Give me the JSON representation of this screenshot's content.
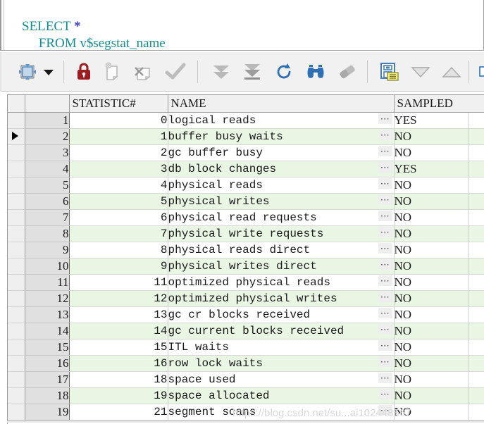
{
  "editor": {
    "line1": {
      "keyword": "SELECT",
      "operator": "*"
    },
    "line2": {
      "keyword": "FROM",
      "object": "v$segstat_name"
    },
    "full_text": "SELECT *\n     FROM v$segstat_name"
  },
  "toolbar": {
    "buttons": [
      {
        "name": "grid-data-button",
        "icon": "grid-data-icon",
        "label": "",
        "enabled": true
      },
      {
        "name": "grid-dropdown-button",
        "icon": "chevron-down-icon",
        "label": "",
        "enabled": true
      },
      {
        "name": "lock-record-button",
        "icon": "lock-icon",
        "label": "",
        "enabled": true
      },
      {
        "name": "insert-record-button",
        "icon": "new-record-icon",
        "label": "",
        "enabled": false
      },
      {
        "name": "delete-record-button",
        "icon": "delete-record-icon",
        "label": "",
        "enabled": false
      },
      {
        "name": "post-changes-button",
        "icon": "checkmark-icon",
        "label": "",
        "enabled": false
      },
      {
        "name": "fetch-next-page-button",
        "icon": "double-down-arrow-icon",
        "label": "",
        "enabled": true
      },
      {
        "name": "fetch-all-rows-button",
        "icon": "down-arrow-to-bar-icon",
        "label": "",
        "enabled": true
      },
      {
        "name": "refresh-button",
        "icon": "refresh-icon",
        "label": "",
        "enabled": true
      },
      {
        "name": "find-button",
        "icon": "binoculars-icon",
        "label": "",
        "enabled": true
      },
      {
        "name": "clear-filter-button",
        "icon": "eraser-icon",
        "label": "",
        "enabled": true
      },
      {
        "name": "single-record-view-button",
        "icon": "record-form-icon",
        "label": "",
        "enabled": true
      },
      {
        "name": "sort-descending-button",
        "icon": "triangle-down-icon",
        "label": "",
        "enabled": true
      },
      {
        "name": "sort-ascending-button",
        "icon": "triangle-up-icon",
        "label": "",
        "enabled": true
      }
    ]
  },
  "grid": {
    "columns": [
      {
        "key": "rownum",
        "label": ""
      },
      {
        "key": "statistic",
        "label": "STATISTIC#"
      },
      {
        "key": "name",
        "label": "NAME"
      },
      {
        "key": "sampled",
        "label": "SAMPLED"
      }
    ],
    "dots_label": "⋯",
    "current_row_index": 2,
    "rows": [
      {
        "rownum": "1",
        "statistic": "0",
        "name": "logical reads",
        "sampled": "YES"
      },
      {
        "rownum": "2",
        "statistic": "1",
        "name": "buffer busy waits",
        "sampled": "NO"
      },
      {
        "rownum": "3",
        "statistic": "2",
        "name": "gc buffer busy",
        "sampled": "NO"
      },
      {
        "rownum": "4",
        "statistic": "3",
        "name": "db block changes",
        "sampled": "YES"
      },
      {
        "rownum": "5",
        "statistic": "4",
        "name": "physical reads",
        "sampled": "NO"
      },
      {
        "rownum": "6",
        "statistic": "5",
        "name": "physical writes",
        "sampled": "NO"
      },
      {
        "rownum": "7",
        "statistic": "6",
        "name": "physical read requests",
        "sampled": "NO"
      },
      {
        "rownum": "8",
        "statistic": "7",
        "name": "physical write requests",
        "sampled": "NO"
      },
      {
        "rownum": "9",
        "statistic": "8",
        "name": "physical reads direct",
        "sampled": "NO"
      },
      {
        "rownum": "10",
        "statistic": "9",
        "name": "physical writes direct",
        "sampled": "NO"
      },
      {
        "rownum": "11",
        "statistic": "11",
        "name": "optimized physical reads",
        "sampled": "NO"
      },
      {
        "rownum": "12",
        "statistic": "12",
        "name": "optimized physical writes",
        "sampled": "NO"
      },
      {
        "rownum": "13",
        "statistic": "13",
        "name": "gc cr blocks received",
        "sampled": "NO"
      },
      {
        "rownum": "14",
        "statistic": "14",
        "name": "gc current blocks received",
        "sampled": "NO"
      },
      {
        "rownum": "15",
        "statistic": "15",
        "name": "ITL waits",
        "sampled": "NO"
      },
      {
        "rownum": "16",
        "statistic": "16",
        "name": "row lock waits",
        "sampled": "NO"
      },
      {
        "rownum": "17",
        "statistic": "18",
        "name": "space used",
        "sampled": "NO"
      },
      {
        "rownum": "18",
        "statistic": "19",
        "name": "space allocated",
        "sampled": "NO"
      },
      {
        "rownum": "19",
        "statistic": "21",
        "name": "segment scans",
        "sampled": "NO"
      }
    ]
  },
  "watermark": {
    "text": "https://blog.csdn.net/su...ai102448567"
  },
  "colors": {
    "sql_keyword": "#0f8f93",
    "sql_operator": "#3b3bc4",
    "alt_row": "#e9f6e4",
    "rownum_bg": "#e0e0e0",
    "toolbar_bg": "#f1f1f1",
    "lock_icon": "#9e1b21",
    "refresh_icon": "#2f6fb5",
    "binoculars_icon": "#2f6fb5"
  }
}
